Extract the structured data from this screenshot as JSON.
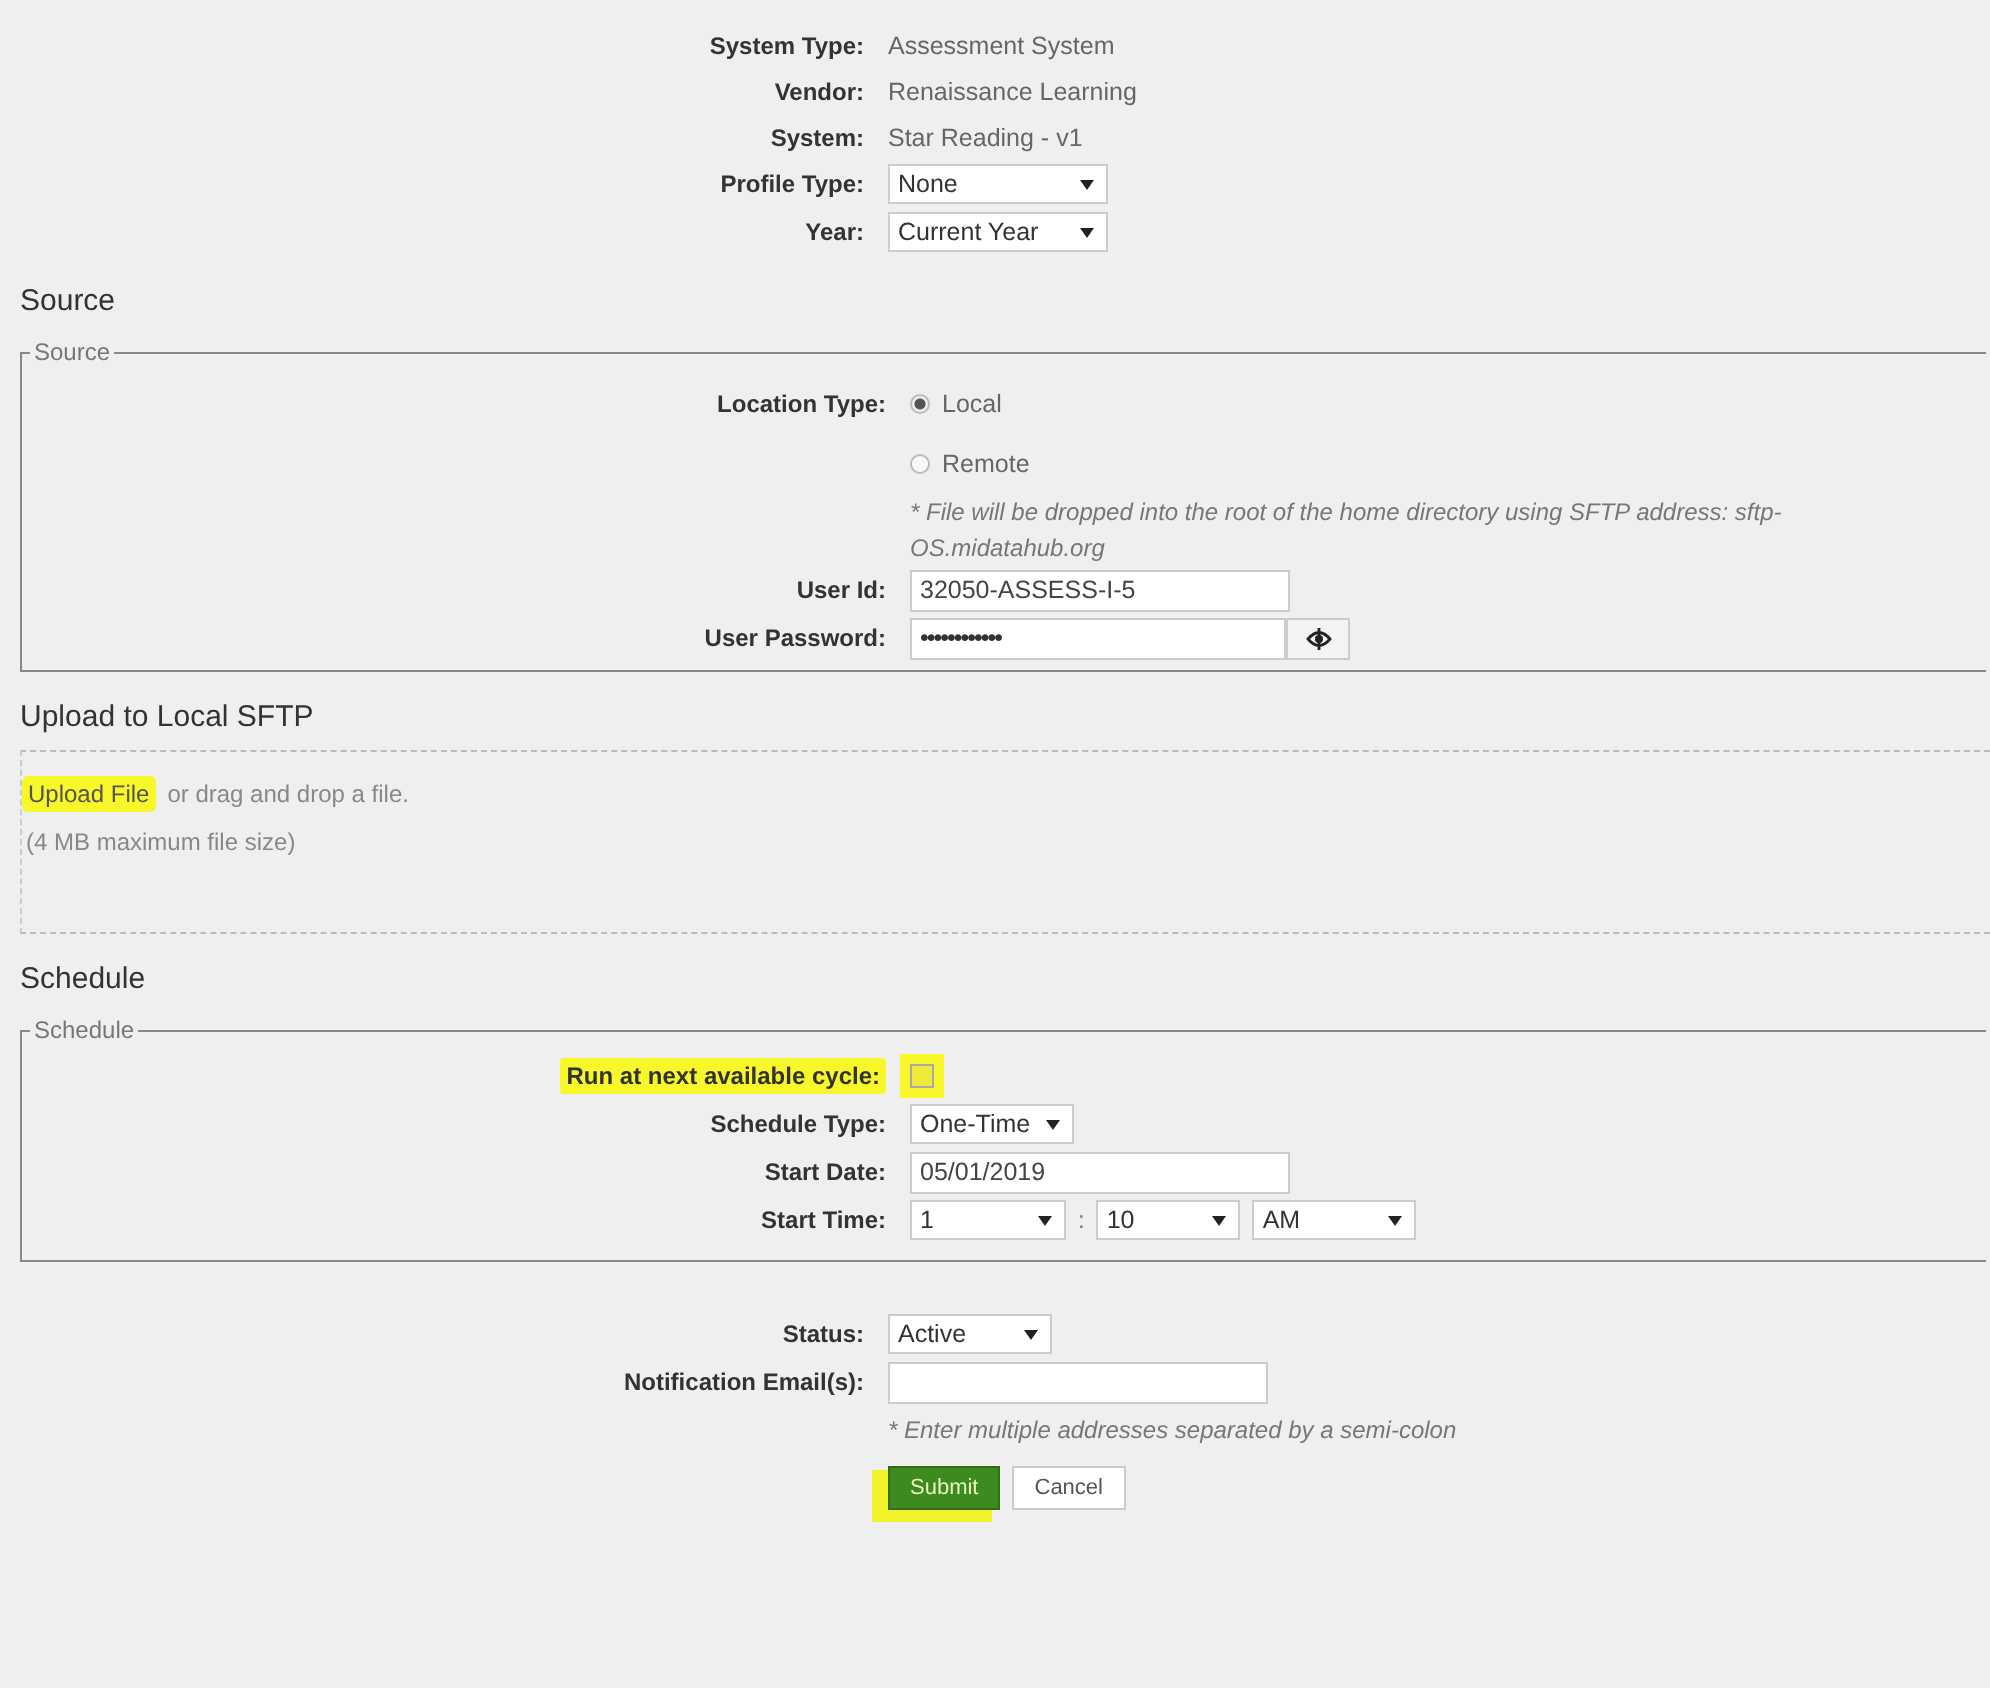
{
  "details": [
    {
      "label": "System Type:",
      "kind": "text",
      "value": "Assessment System"
    },
    {
      "label": "Vendor:",
      "kind": "text",
      "value": "Renaissance Learning"
    },
    {
      "label": "System:",
      "kind": "text",
      "value": "Star Reading - v1"
    },
    {
      "label": "Profile Type:",
      "kind": "select",
      "value": "None"
    },
    {
      "label": "Year:",
      "kind": "select",
      "value": "Current Year"
    }
  ],
  "source": {
    "heading": "Source",
    "legend": "Source",
    "location_label": "Location Type:",
    "options": [
      {
        "label": "Local",
        "selected": true
      },
      {
        "label": "Remote",
        "selected": false
      }
    ],
    "note": "* File will be dropped into the root of the home directory using SFTP address: sftp-OS.midatahub.org",
    "user_id": {
      "label": "User Id:",
      "value": "32050-ASSESS-I-5"
    },
    "password": {
      "label": "User Password:",
      "value": "••••••••••••"
    }
  },
  "upload": {
    "heading": "Upload to Local SFTP",
    "button": "Upload File",
    "highlighted": true,
    "drop_text": "or drag and drop a file.",
    "size_note": "(4 MB maximum file size)"
  },
  "schedule": {
    "heading": "Schedule",
    "legend": "Schedule",
    "run_next": {
      "label": "Run at next available cycle:",
      "checked": false,
      "highlighted": true
    },
    "type": {
      "label": "Schedule Type:",
      "value": "One-Time"
    },
    "start_date": {
      "label": "Start Date:",
      "value": "05/01/2019"
    },
    "start_time": {
      "label": "Start Time:",
      "hour": "1",
      "separator": ":",
      "minute": "10",
      "period": "AM"
    }
  },
  "status": {
    "label": "Status:",
    "value": "Active"
  },
  "email": {
    "label": "Notification Email(s):",
    "note": "* Enter multiple addresses separated by a semi-colon"
  },
  "buttons": [
    {
      "label": "Submit",
      "kind": "primary",
      "highlighted": true
    },
    {
      "label": "Cancel",
      "kind": "secondary"
    }
  ]
}
